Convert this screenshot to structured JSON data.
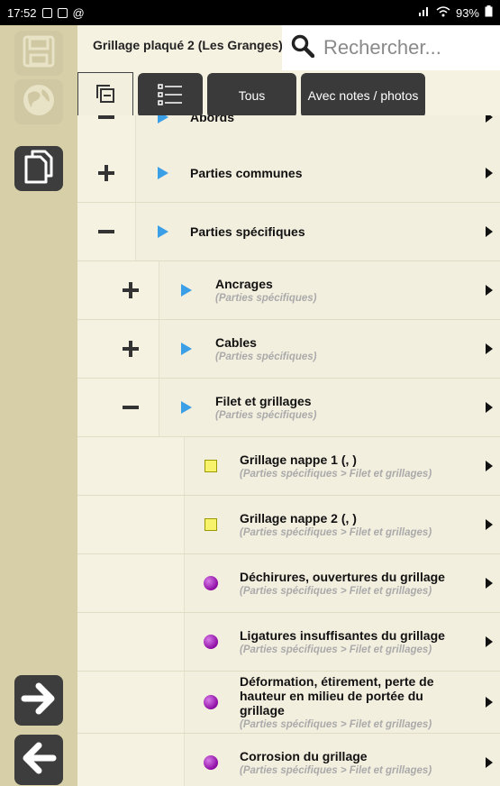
{
  "status": {
    "time": "17:52",
    "battery": "93%"
  },
  "header": {
    "title": "Grillage plaqué 2 (Les Granges)",
    "search": {
      "placeholder": "Rechercher...",
      "value": ""
    },
    "buttons": {
      "tous": "Tous",
      "notes": "Avec notes / photos"
    }
  },
  "tree": {
    "partial_top": "Abords",
    "rows": [
      {
        "label": "Parties communes",
        "sub": ""
      },
      {
        "label": "Parties spécifiques",
        "sub": ""
      },
      {
        "label": "Ancrages",
        "sub": "(Parties spécifiques)"
      },
      {
        "label": "Cables",
        "sub": "(Parties spécifiques)"
      },
      {
        "label": "Filet et grillages",
        "sub": "(Parties spécifiques)"
      },
      {
        "label": "Grillage nappe 1 (, )",
        "sub": "(Parties spécifiques > Filet et grillages)"
      },
      {
        "label": "Grillage nappe 2 (, )",
        "sub": "(Parties spécifiques > Filet et grillages)"
      },
      {
        "label": "Déchirures, ouvertures du grillage",
        "sub": "(Parties spécifiques > Filet et grillages)"
      },
      {
        "label": "Ligatures insuffisantes du grillage",
        "sub": "(Parties spécifiques > Filet et grillages)"
      },
      {
        "label": "Déformation, étirement, perte de hauteur en milieu de portée du grillage",
        "sub": "(Parties spécifiques > Filet et grillages)"
      },
      {
        "label": "Corrosion du grillage",
        "sub": "(Parties spécifiques > Filet et grillages)"
      }
    ]
  }
}
